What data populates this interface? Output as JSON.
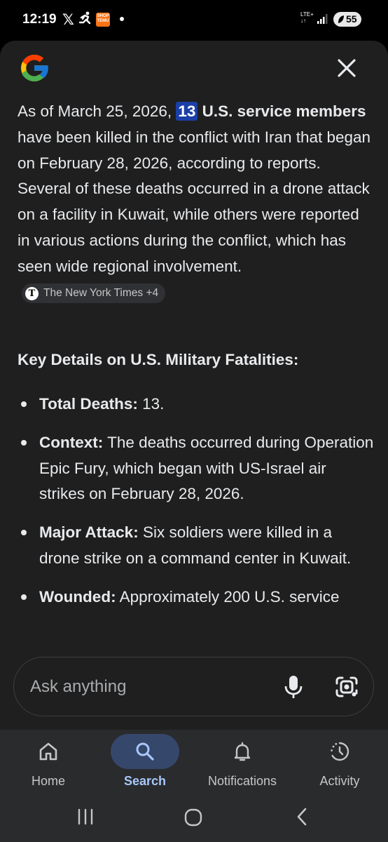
{
  "status_bar": {
    "time": "12:19",
    "x_glyph": "𝕏",
    "temu_label": "SHOP\nTEMU",
    "network": "LTE+",
    "battery": "55"
  },
  "header": {
    "logo_icon": "google-g-icon",
    "close_icon": "close-icon"
  },
  "answer": {
    "prefix": "As of March 25, 2026, ",
    "highlight_number": "13",
    "bold_phrase": " U.S. service members",
    "body": " have been killed in the conflict with Iran that began on February 28, 2026, according to reports. Several of these deaths occurred in a drone attack on a facility in Kuwait, while others were reported in various actions during the conflict, which has seen wide regional involvement.",
    "source_chip": "The New York Times +4",
    "source_icon_letter": "T"
  },
  "key_details": {
    "heading": "Key Details on U.S. Military Fatalities:",
    "items": [
      {
        "label": "Total Deaths:",
        "text": " 13."
      },
      {
        "label": "Context:",
        "text": " The deaths occurred during Operation Epic Fury, which began with US-Israel air strikes on February 28, 2026."
      },
      {
        "label": "Major Attack:",
        "text": " Six soldiers were killed in a drone strike on a command center in Kuwait."
      },
      {
        "label": "Wounded:",
        "text": " Approximately 200 U.S. service"
      }
    ]
  },
  "search": {
    "placeholder": "Ask anything",
    "mic_icon": "microphone-icon",
    "lens_icon": "google-lens-icon"
  },
  "bottom_nav": {
    "items": [
      {
        "label": "Home",
        "icon": "home-icon",
        "active": false
      },
      {
        "label": "Search",
        "icon": "search-icon",
        "active": true
      },
      {
        "label": "Notifications",
        "icon": "bell-icon",
        "active": false
      },
      {
        "label": "Activity",
        "icon": "activity-clock-icon",
        "active": false
      }
    ]
  },
  "colors": {
    "background": "#1f1f1f",
    "highlight": "#1a3fa6",
    "active_nav": "#a8c7fa",
    "nav_pill": "#35476b"
  }
}
